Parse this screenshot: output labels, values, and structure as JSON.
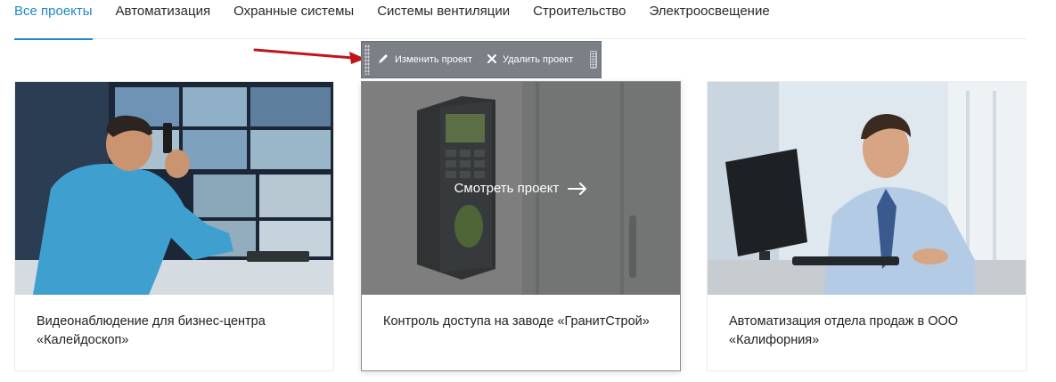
{
  "tabs": [
    {
      "label": "Все проекты",
      "active": true
    },
    {
      "label": "Автоматизация",
      "active": false
    },
    {
      "label": "Охранные системы",
      "active": false
    },
    {
      "label": "Системы вентиляции",
      "active": false
    },
    {
      "label": "Строительство",
      "active": false
    },
    {
      "label": "Электроосвещение",
      "active": false
    }
  ],
  "toolbar": {
    "edit_label": "Изменить проект",
    "delete_label": "Удалить проект"
  },
  "projects": [
    {
      "title": "Видеонаблюдение для бизнес-центра «Калейдоскоп»"
    },
    {
      "title": "Контроль доступа на заводе «ГранитСтрой»",
      "overlay_label": "Смотреть проект"
    },
    {
      "title": "Автоматизация отдела продаж в ООО «Калифорния»"
    }
  ],
  "colors": {
    "accent": "#1e88c9",
    "annotation_arrow": "#c0161b"
  }
}
